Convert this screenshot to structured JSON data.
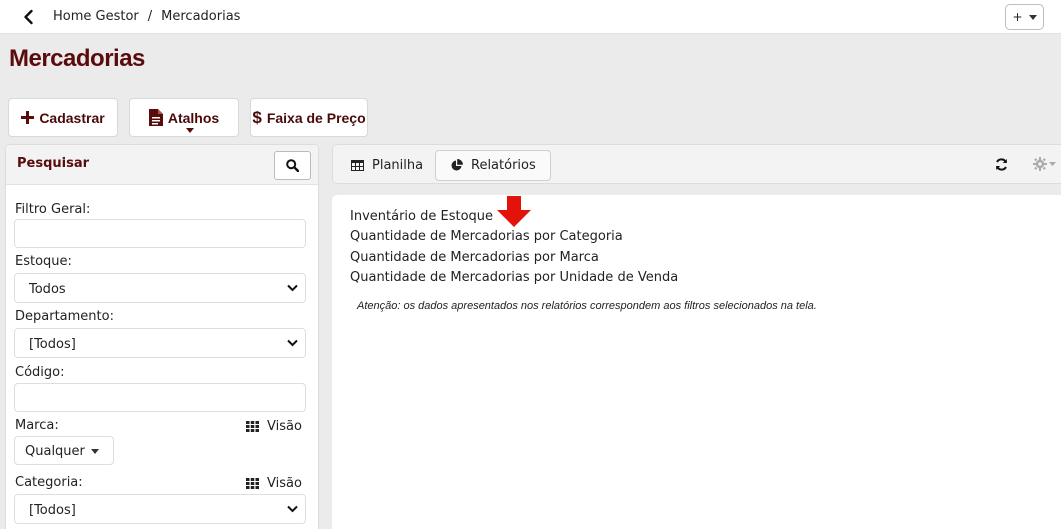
{
  "breadcrumb": {
    "home": "Home Gestor",
    "separator": "/",
    "current": "Mercadorias"
  },
  "header_plus": "+",
  "page": {
    "title": "Mercadorias"
  },
  "toolbar": {
    "cadastrar": "Cadastrar",
    "atalhos": "Atalhos",
    "faixa": "Faixa de Preço"
  },
  "filters": {
    "title": "Pesquisar",
    "filtro_geral": {
      "label": "Filtro Geral:",
      "value": ""
    },
    "estoque": {
      "label": "Estoque:",
      "value": "Todos"
    },
    "departamento": {
      "label": "Departamento:",
      "value": "[Todos]"
    },
    "codigo": {
      "label": "Código:",
      "value": ""
    },
    "marca": {
      "label": "Marca:",
      "visao": "Visão",
      "value": "Qualquer"
    },
    "categoria": {
      "label": "Categoria:",
      "visao": "Visão",
      "value": "[Todos]"
    }
  },
  "tabs": [
    {
      "label": "Planilha",
      "icon": "table-icon",
      "active": false
    },
    {
      "label": "Relatórios",
      "icon": "pie-chart-icon",
      "active": true
    }
  ],
  "reports": [
    "Inventário de Estoque",
    "Quantidade de Mercadorias por Categoria",
    "Quantidade de Mercadorias por Marca",
    "Quantidade de Mercadorias por Unidade de Venda"
  ],
  "note": "Atenção: os dados apresentados nos relatórios correspondem aos filtros selecionados na tela.",
  "colors": {
    "brand": "#5a0c0c",
    "arrow": "#e3120b",
    "background": "#ebebeb"
  }
}
